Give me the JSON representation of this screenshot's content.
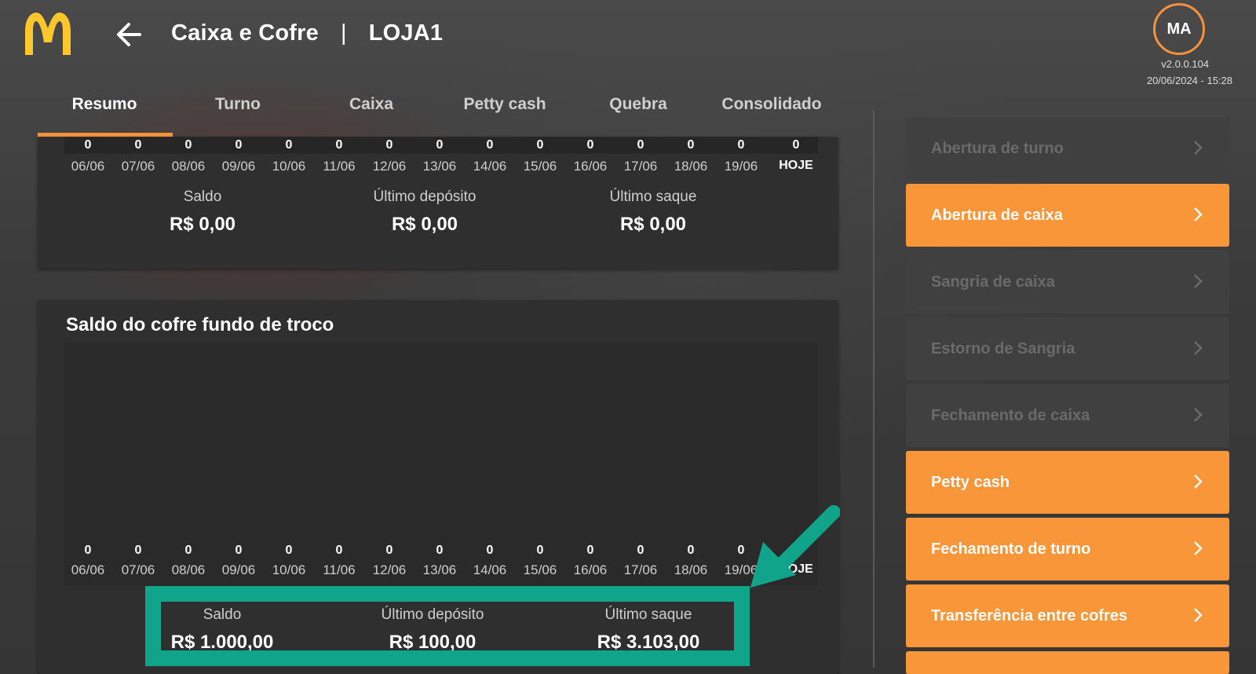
{
  "header": {
    "title": "Caixa e Cofre",
    "separator": "|",
    "store": "LOJA1",
    "user_initials": "MA",
    "version": "v2.0.0.104",
    "datetime": "20/06/2024 - 15:28"
  },
  "tabs": [
    {
      "label": "Resumo",
      "active": true
    },
    {
      "label": "Turno",
      "active": false
    },
    {
      "label": "Caixa",
      "active": false
    },
    {
      "label": "Petty cash",
      "active": false
    },
    {
      "label": "Quebra",
      "active": false
    },
    {
      "label": "Consolidado",
      "active": false
    }
  ],
  "days": [
    "06/06",
    "07/06",
    "08/06",
    "09/06",
    "10/06",
    "11/06",
    "12/06",
    "13/06",
    "14/06",
    "15/06",
    "16/06",
    "17/06",
    "18/06",
    "19/06",
    "HOJE"
  ],
  "card1": {
    "values": [
      "0",
      "0",
      "0",
      "0",
      "0",
      "0",
      "0",
      "0",
      "0",
      "0",
      "0",
      "0",
      "0",
      "0",
      "0"
    ],
    "saldo_label": "Saldo",
    "saldo_value": "R$ 0,00",
    "deposito_label": "Último depósito",
    "deposito_value": "R$ 0,00",
    "saque_label": "Último saque",
    "saque_value": "R$ 0,00"
  },
  "card2": {
    "title": "Saldo do cofre fundo de troco",
    "values": [
      "0",
      "0",
      "0",
      "0",
      "0",
      "0",
      "0",
      "0",
      "0",
      "0",
      "0",
      "0",
      "0",
      "0"
    ],
    "saldo_label": "Saldo",
    "saldo_value": "R$ 1.000,00",
    "deposito_label": "Último depósito",
    "deposito_value": "R$ 100,00",
    "saque_label": "Último saque",
    "saque_value": "R$ 3.103,00"
  },
  "menu": [
    {
      "label": "Abertura de turno",
      "enabled": false
    },
    {
      "label": "Abertura de caixa",
      "enabled": true
    },
    {
      "label": "Sangria de caixa",
      "enabled": false
    },
    {
      "label": "Estorno de Sangria",
      "enabled": false
    },
    {
      "label": "Fechamento de caixa",
      "enabled": false
    },
    {
      "label": "Petty cash",
      "enabled": true
    },
    {
      "label": "Fechamento de turno",
      "enabled": true
    },
    {
      "label": "Transferência entre cofres",
      "enabled": true
    }
  ],
  "colors": {
    "accent": "#f9963a",
    "highlight": "#10a58a",
    "disabled_button": "#404040"
  }
}
